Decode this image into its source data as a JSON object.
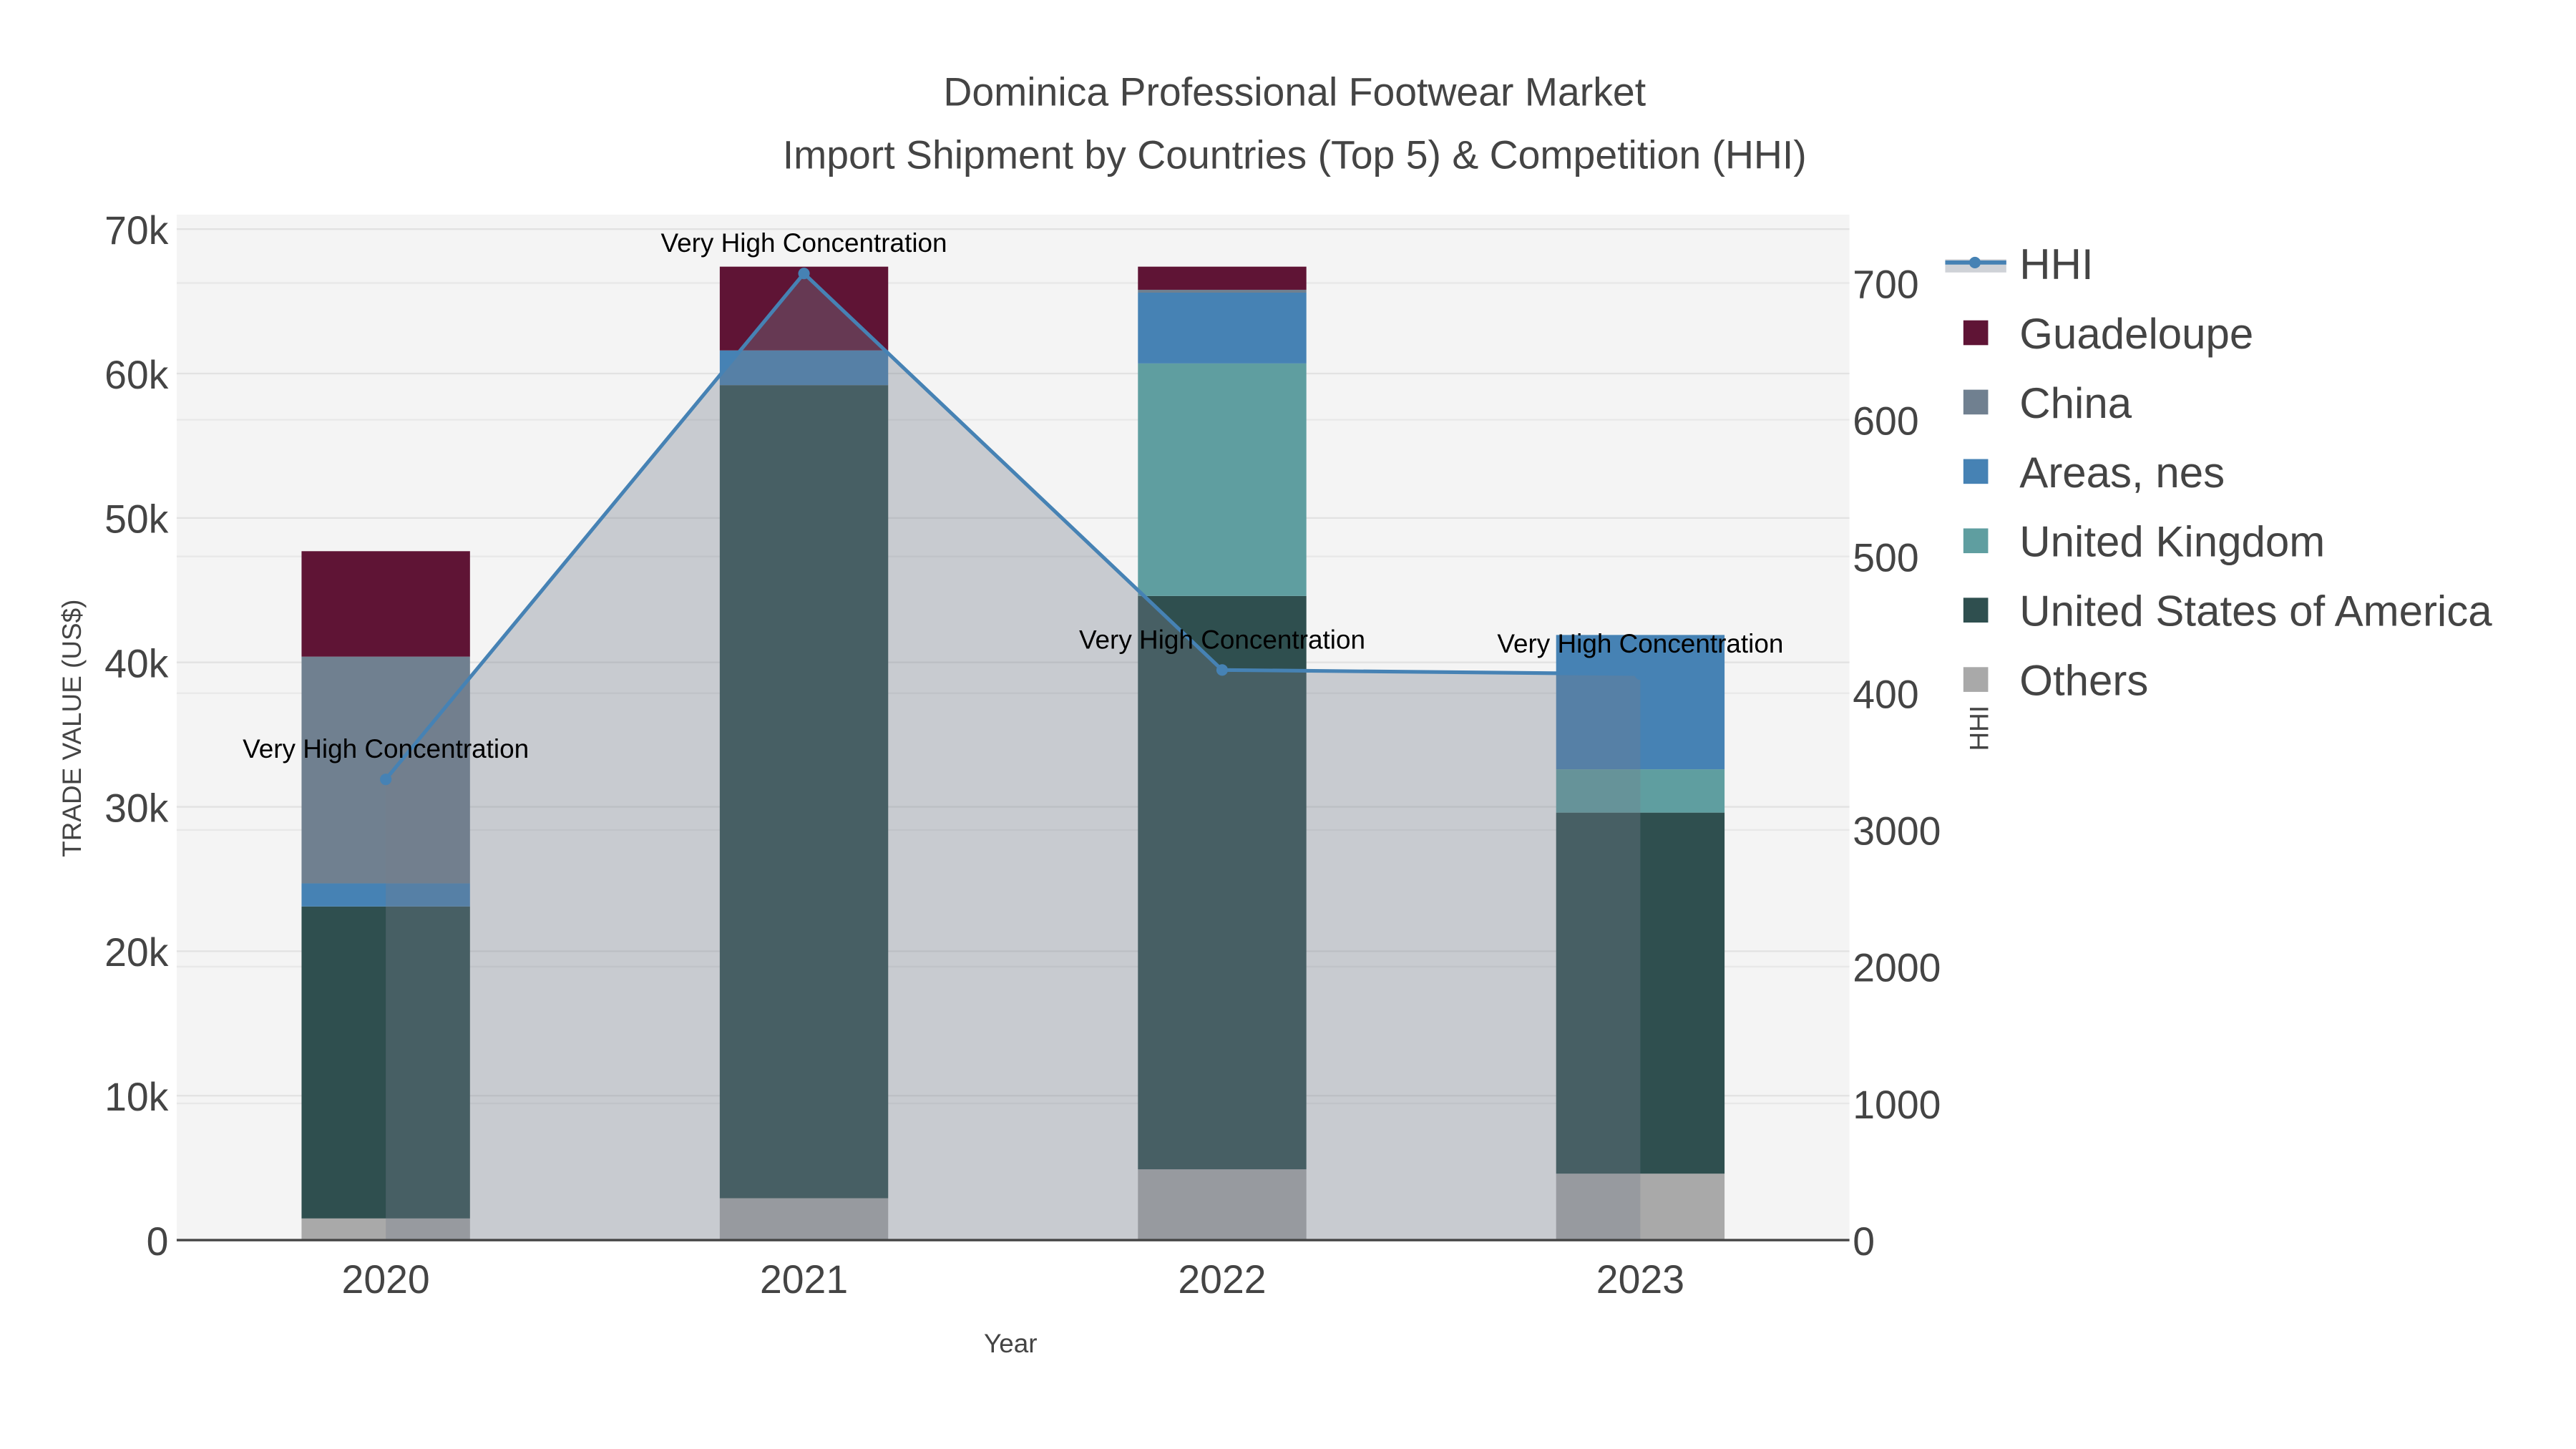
{
  "chart_data": {
    "type": "bar",
    "stacked": true,
    "title": "Dominica Professional Footwear Market",
    "subtitle": "Import Shipment by Countries (Top 5) & Competition (HHI)",
    "xlabel": "Year",
    "ylabel": "TRADE VALUE (US$)",
    "y2label": "HHI",
    "categories": [
      "2020",
      "2021",
      "2022",
      "2023"
    ],
    "ylim": [
      0,
      71000
    ],
    "y2lim": [
      0,
      7500
    ],
    "yticks": [
      {
        "v": 0,
        "label": "0"
      },
      {
        "v": 10000,
        "label": "10k"
      },
      {
        "v": 20000,
        "label": "20k"
      },
      {
        "v": 30000,
        "label": "30k"
      },
      {
        "v": 40000,
        "label": "40k"
      },
      {
        "v": 50000,
        "label": "50k"
      },
      {
        "v": 60000,
        "label": "60k"
      },
      {
        "v": 70000,
        "label": "70k"
      }
    ],
    "y2ticks": [
      {
        "v": 0,
        "label": "0"
      },
      {
        "v": 1000,
        "label": "1000"
      },
      {
        "v": 2000,
        "label": "2000"
      },
      {
        "v": 3000,
        "label": "3000"
      },
      {
        "v": 4000,
        "label": "400"
      },
      {
        "v": 5000,
        "label": "500"
      },
      {
        "v": 6000,
        "label": "600"
      },
      {
        "v": 7000,
        "label": "700"
      }
    ],
    "series": [
      {
        "name": "Others",
        "color": "#a9a9a9",
        "values": [
          1500,
          2900,
          4900,
          4600
        ]
      },
      {
        "name": "United States of America",
        "color": "#2f4f4f",
        "values": [
          21600,
          56300,
          39700,
          25000
        ]
      },
      {
        "name": "United Kingdom",
        "color": "#5f9ea0",
        "values": [
          0,
          0,
          16100,
          3000
        ]
      },
      {
        "name": "Areas, nes",
        "color": "#4682b4",
        "values": [
          1600,
          2400,
          4900,
          9300
        ]
      },
      {
        "name": "China",
        "color": "#708090",
        "values": [
          15700,
          0,
          200,
          0
        ]
      },
      {
        "name": "Guadeloupe",
        "color": "#5f1435",
        "values": [
          7300,
          5800,
          1600,
          0
        ]
      }
    ],
    "hhi": {
      "name": "HHI",
      "color": "#4682b4",
      "values": [
        3370,
        7070,
        4170,
        4140
      ]
    },
    "annotations": [
      "Very High Concentration",
      "Very High Concentration",
      "Very High Concentration",
      "Very High Concentration"
    ],
    "legend": [
      "HHI",
      "Guadeloupe",
      "China",
      "Areas, nes",
      "United Kingdom",
      "United States of America",
      "Others"
    ],
    "legend_position": "top-right",
    "grid": true
  }
}
